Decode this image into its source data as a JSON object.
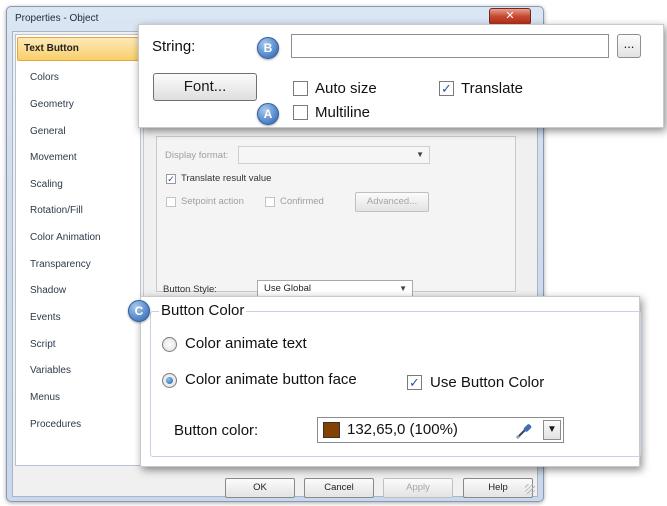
{
  "window": {
    "title": "Properties - Object",
    "close_glyph": "✕"
  },
  "sidebar": {
    "items": [
      {
        "label": "Text Button",
        "active": true
      },
      {
        "label": "Colors"
      },
      {
        "label": "Geometry"
      },
      {
        "label": "General"
      },
      {
        "label": "Movement"
      },
      {
        "label": "Scaling"
      },
      {
        "label": "Rotation/Fill"
      },
      {
        "label": "Color Animation"
      },
      {
        "label": "Transparency"
      },
      {
        "label": "Shadow"
      },
      {
        "label": "Events"
      },
      {
        "label": "Script"
      },
      {
        "label": "Variables"
      },
      {
        "label": "Menus"
      },
      {
        "label": "Procedures"
      }
    ]
  },
  "background_form": {
    "display_format_label": "Display format:",
    "translate_result_label": "Translate result value",
    "translate_result_checked": true,
    "setpoint_label": "Setpoint action",
    "confirmed_label": "Confirmed",
    "advanced_label": "Advanced...",
    "button_style_label": "Button Style:",
    "button_style_value": "Use Global"
  },
  "footer": {
    "ok": "OK",
    "cancel": "Cancel",
    "apply": "Apply",
    "help": "Help"
  },
  "zoom_top": {
    "string_label": "String:",
    "string_value": "",
    "browse_label": "...",
    "font_button": "Font...",
    "auto_size_label": "Auto size",
    "auto_size_checked": false,
    "translate_label": "Translate",
    "translate_checked": true,
    "multiline_label": "Multiline",
    "multiline_checked": false
  },
  "zoom_color": {
    "group_title": "Button Color",
    "radio_text_label": "Color animate text",
    "radio_face_label": "Color animate button face",
    "selected": "face",
    "use_button_color_label": "Use Button Color",
    "use_button_color_checked": true,
    "button_color_label": "Button color:",
    "button_color_value": "132,65,0 (100%)",
    "swatch_color": "#844100"
  },
  "badges": {
    "a": "A",
    "b": "B",
    "c": "C"
  },
  "check_glyph": "✓"
}
